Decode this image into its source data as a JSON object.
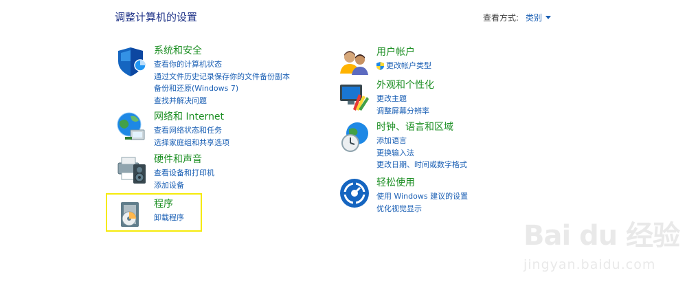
{
  "header": {
    "title": "调整计算机的设置",
    "view_by_label": "查看方式:",
    "view_by_value": "类别"
  },
  "categories": [
    {
      "icon": "shield-security-icon",
      "title": "系统和安全",
      "links": [
        "查看你的计算机状态",
        "通过文件历史记录保存你的文件备份副本",
        "备份和还原(Windows 7)",
        "查找并解决问题"
      ]
    },
    {
      "icon": "network-globe-icon",
      "title": "网络和 Internet",
      "links": [
        "查看网络状态和任务",
        "选择家庭组和共享选项"
      ]
    },
    {
      "icon": "printer-speaker-icon",
      "title": "硬件和声音",
      "links": [
        "查看设备和打印机",
        "添加设备"
      ]
    },
    {
      "icon": "programs-disc-icon",
      "title": "程序",
      "links": [
        "卸载程序"
      ]
    },
    {
      "icon": "users-icon",
      "title": "用户帐户",
      "links": [
        "更改帐户类型"
      ]
    },
    {
      "icon": "appearance-monitor-icon",
      "title": "外观和个性化",
      "links": [
        "更改主题",
        "调整屏幕分辨率"
      ]
    },
    {
      "icon": "clock-globe-icon",
      "title": "时钟、语言和区域",
      "links": [
        "添加语言",
        "更换输入法",
        "更改日期、时间或数字格式"
      ]
    },
    {
      "icon": "ease-of-access-icon",
      "title": "轻松使用",
      "links": [
        "使用 Windows 建议的设置",
        "优化视觉显示"
      ]
    }
  ],
  "watermark": {
    "logo": "Bai du 经验",
    "url": "jingyan.baidu.com"
  },
  "colors": {
    "title_green": "#1d8f24",
    "link_blue": "#1a5fb4",
    "header_blue": "#1e3287",
    "highlight_yellow": "#f5ea0a"
  }
}
